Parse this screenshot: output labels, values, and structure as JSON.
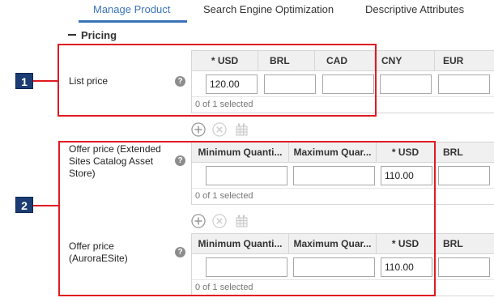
{
  "tabs": [
    {
      "label": "Manage Product",
      "active": true
    },
    {
      "label": "Search Engine Optimization",
      "active": false
    },
    {
      "label": "Descriptive Attributes",
      "active": false
    }
  ],
  "section": {
    "collapse_symbol": "—",
    "title": "Pricing"
  },
  "list_price": {
    "label": "List price",
    "help": "?",
    "columns": [
      "* USD",
      "BRL",
      "CAD",
      "CNY",
      "EUR"
    ],
    "values": [
      "120.00",
      "",
      "",
      "",
      ""
    ],
    "footer": "0 of 1 selected"
  },
  "offer_price_extended": {
    "label": "Offer price (Extended Sites Catalog Asset Store)",
    "help": "?",
    "columns": [
      "Minimum Quanti...",
      "Maximum Quar...",
      "* USD",
      "BRL"
    ],
    "values": [
      "",
      "",
      "110.00",
      ""
    ],
    "footer": "0 of 1 selected"
  },
  "offer_price_aurora": {
    "label": "Offer price (AuroraESite)",
    "help": "?",
    "columns": [
      "Minimum Quanti...",
      "Maximum Quar...",
      "* USD",
      "BRL"
    ],
    "values": [
      "",
      "",
      "110.00",
      ""
    ],
    "footer": "0 of 1 selected"
  },
  "callouts": {
    "one": "1",
    "two": "2"
  },
  "colors": {
    "accent": "#3b73b9",
    "callout": "#e01a22",
    "badge": "#1b3d73"
  },
  "icons": {
    "add": "add-icon",
    "remove": "remove-icon",
    "table": "table-icon",
    "help": "help-icon"
  }
}
